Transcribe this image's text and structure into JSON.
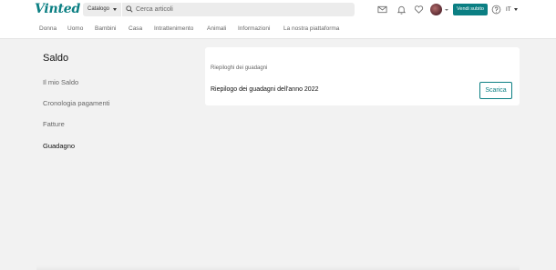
{
  "header": {
    "logo": "Vinted",
    "catalog_label": "Catalogo",
    "search_placeholder": "Cerca articoli",
    "sell_button": "Vendi subito",
    "language": "IT",
    "accent_color": "#0b7f83",
    "icons": [
      "mail-icon",
      "bell-icon",
      "heart-icon",
      "help-icon"
    ]
  },
  "nav": {
    "categories": [
      "Donna",
      "Uomo",
      "Bambini",
      "Casa",
      "Intrattenimento",
      "Animali",
      "Informazioni",
      "La nostra piattaforma"
    ]
  },
  "sidebar": {
    "title": "Saldo",
    "items": [
      {
        "label": "Il mio Saldo",
        "active": false
      },
      {
        "label": "Cronologia pagamenti",
        "active": false
      },
      {
        "label": "Fatture",
        "active": false
      },
      {
        "label": "Guadagno",
        "active": true
      }
    ]
  },
  "main": {
    "section_title": "Riepiloghi dei guadagni",
    "row_label": "Riepilogo dei guadagni dell'anno 2022",
    "download_button": "Scarica"
  }
}
